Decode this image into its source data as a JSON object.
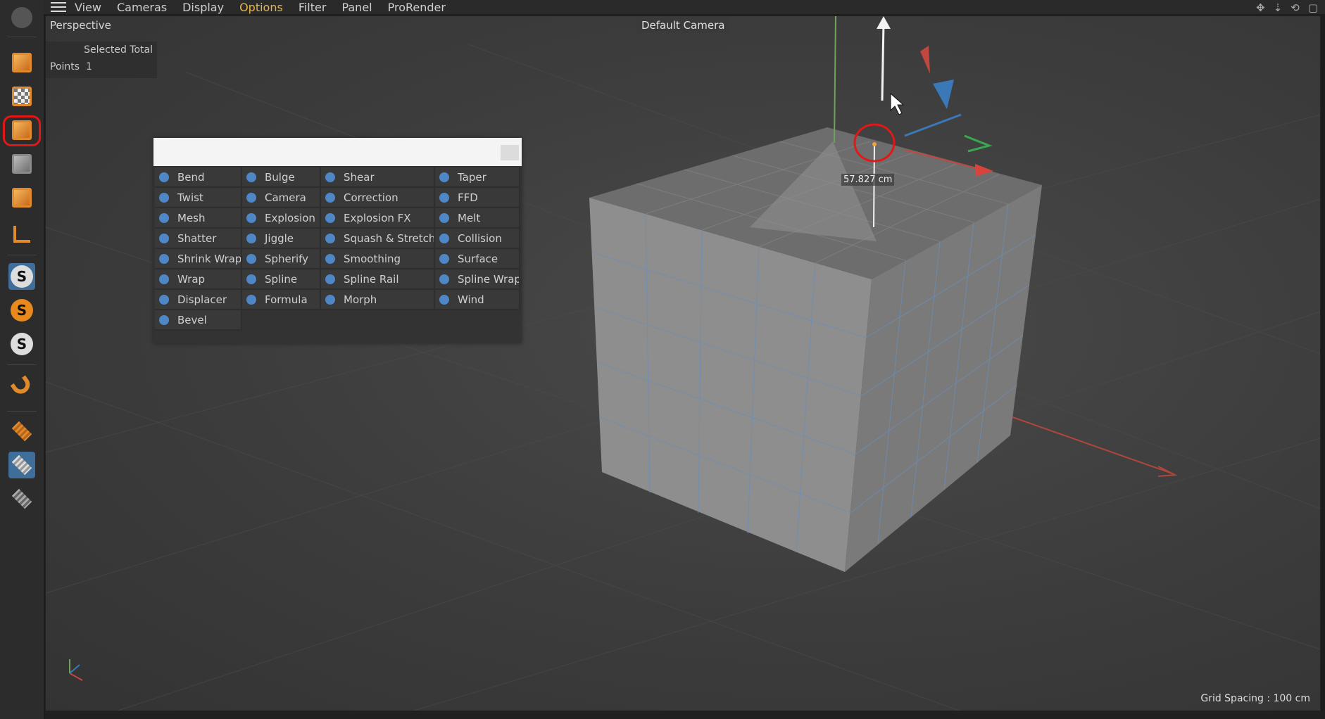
{
  "menu": {
    "items": [
      "View",
      "Cameras",
      "Display",
      "Options",
      "Filter",
      "Panel",
      "ProRender"
    ],
    "active": "Options",
    "right_icons": [
      "move-icon",
      "pan-icon",
      "rotate-icon",
      "maximize-icon"
    ]
  },
  "toolbar": {
    "buttons": [
      "cube-icon",
      "checker-cube-icon",
      "edit-cube-icon",
      "grey-cube-icon",
      "orange-cube-icon",
      "axis-icon",
      "snap-s-icon",
      "snap-s-orange-icon",
      "snap-s-grey-icon",
      "magnet-icon",
      "plane-icon",
      "locked-plane-icon",
      "plane-gear-icon"
    ],
    "highlighted": "edit-cube-icon"
  },
  "viewport": {
    "mode": "Perspective",
    "camera": "Default Camera",
    "hud": {
      "header": "Selected Total",
      "row_label": "Points",
      "row_value": "1"
    },
    "measure": "57.827 cm",
    "grid_spacing": "Grid Spacing : 100 cm"
  },
  "popup": {
    "search_value": "",
    "items": [
      "Bend",
      "Bulge",
      "Shear",
      "Taper",
      "Twist",
      "Camera",
      "Correction",
      "FFD",
      "Mesh",
      "Explosion",
      "Explosion FX",
      "Melt",
      "Shatter",
      "Jiggle",
      "Squash & Stretch",
      "Collision",
      "Shrink Wrap",
      "Spherify",
      "Smoothing",
      "Surface",
      "Wrap",
      "Spline",
      "Spline Rail",
      "Spline Wrap",
      "Displacer",
      "Formula",
      "Morph",
      "Wind",
      "Bevel"
    ]
  },
  "colors": {
    "accent": "#e6b44a",
    "highlight": "#e21818",
    "icon_blue": "#4f87c6"
  }
}
